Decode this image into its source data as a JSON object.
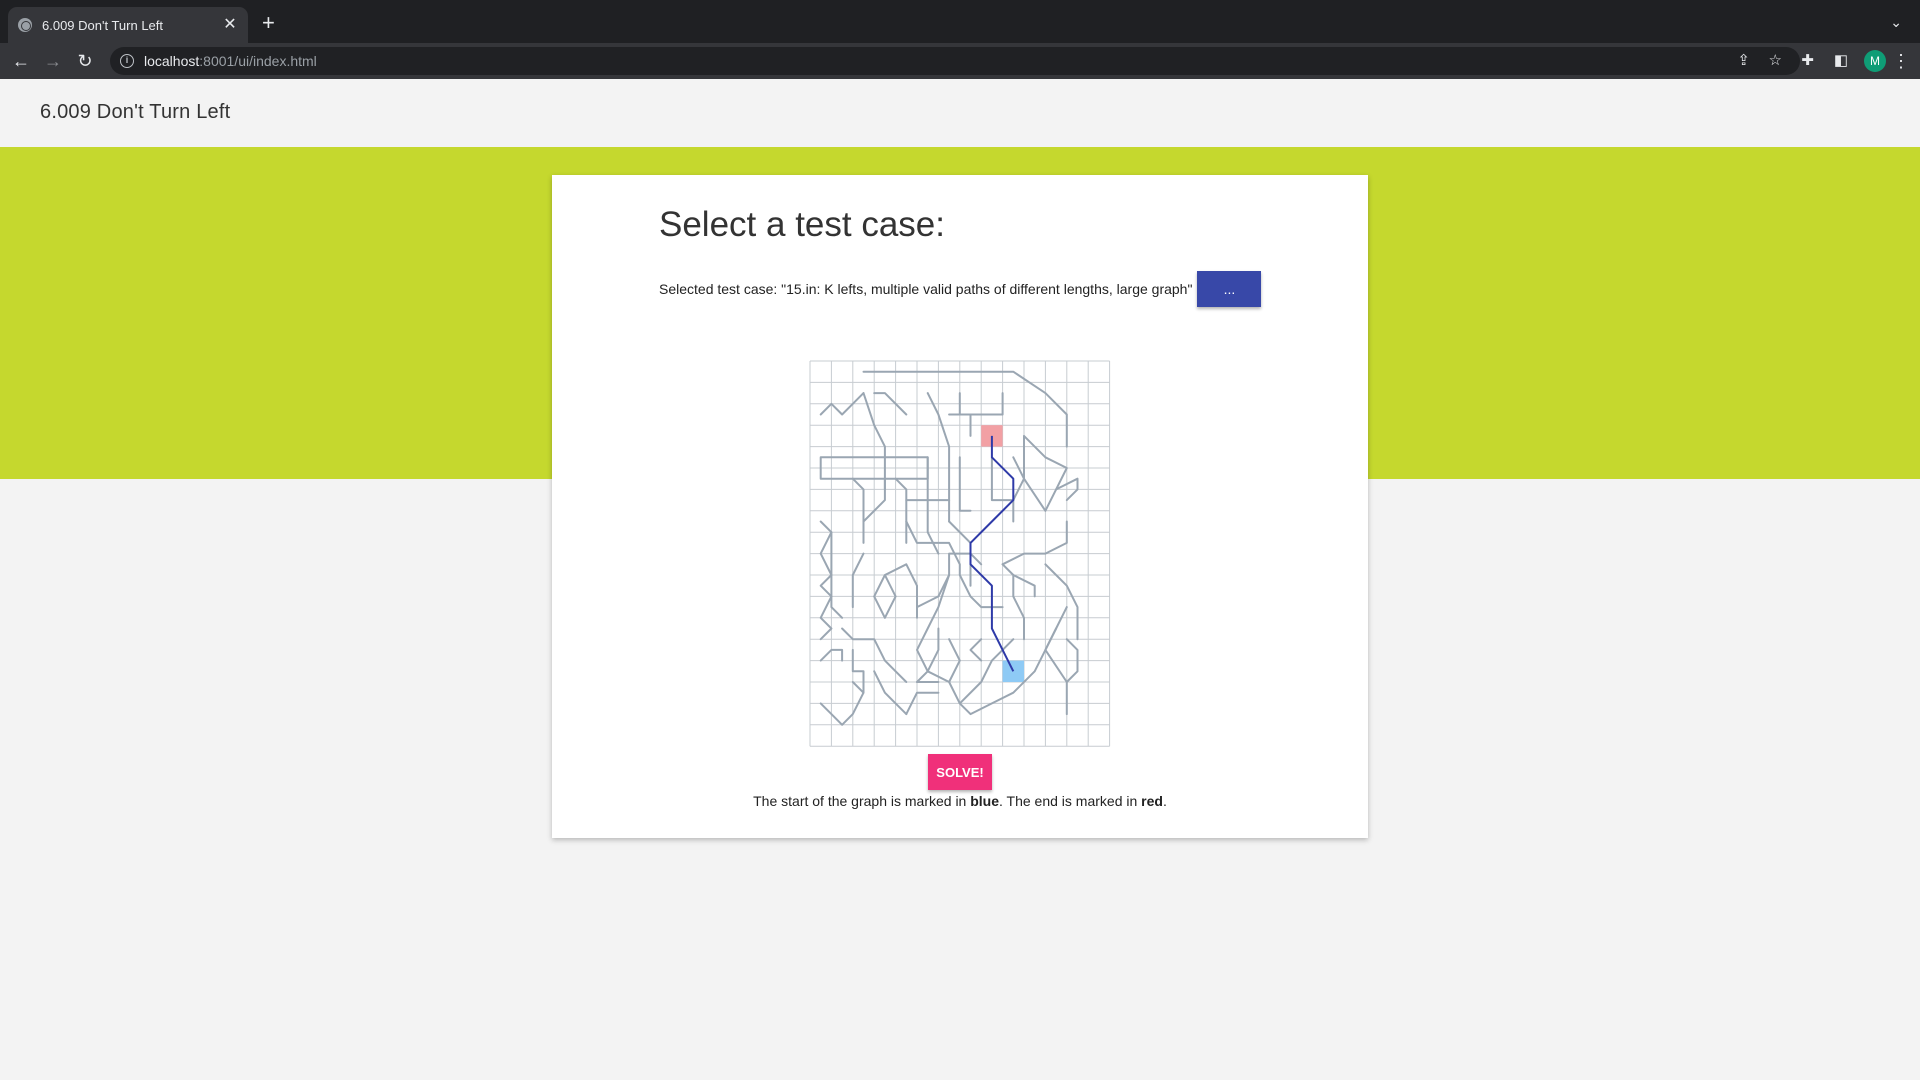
{
  "browser": {
    "tab_title": "6.009 Don't Turn Left",
    "tab_close": "✕",
    "new_tab": "+",
    "tab_list": "⌄",
    "url_host": "localhost",
    "url_rest": ":8001/ui/index.html",
    "avatar_letter": "M"
  },
  "app": {
    "title": "6.009 Don't Turn Left"
  },
  "card": {
    "heading": "Select a test case:",
    "selected_label": "Selected test case: \"15.in: K lefts, multiple valid paths of different lengths, large graph\"",
    "pick_button": "...",
    "solve_button": "SOLVE!",
    "legend_prefix": "The start of the graph is marked in ",
    "legend_start_word": "blue",
    "legend_middle": ". The end is marked in ",
    "legend_end_word": "red",
    "legend_suffix": "."
  },
  "graph": {
    "cols": 14,
    "rows": 18,
    "colors": {
      "grid": "#c7ccd1",
      "edges": "#9aa6b2",
      "path": "#2e3aa8",
      "start": "#8ecaf5",
      "end": "#f2a0a4"
    },
    "start_cell": [
      9,
      14
    ],
    "end_cell": [
      8,
      3
    ],
    "path": [
      [
        9,
        14
      ],
      [
        8,
        12
      ],
      [
        8,
        10
      ],
      [
        7,
        9
      ],
      [
        7,
        8
      ],
      [
        8,
        7
      ],
      [
        9,
        6
      ],
      [
        9,
        5
      ],
      [
        8,
        4
      ],
      [
        8,
        3
      ]
    ],
    "edges": [
      [
        [
          2.5,
          0.5
        ],
        [
          9.5,
          0.5
        ],
        [
          11,
          1.5
        ],
        [
          12,
          2.5
        ],
        [
          12,
          4
        ]
      ],
      [
        [
          0.5,
          2.5
        ],
        [
          1,
          2
        ],
        [
          1.5,
          2.5
        ],
        [
          2,
          2
        ],
        [
          2.5,
          1.5
        ]
      ],
      [
        [
          2.5,
          1.5
        ],
        [
          3,
          3
        ],
        [
          3.5,
          4
        ],
        [
          3.5,
          6
        ]
      ],
      [
        [
          3,
          1.5
        ],
        [
          3.5,
          1.5
        ],
        [
          4.5,
          2.5
        ]
      ],
      [
        [
          5.5,
          1.5
        ],
        [
          6,
          2.5
        ],
        [
          6.5,
          4
        ],
        [
          6.5,
          7.5
        ]
      ],
      [
        [
          7,
          1.5
        ],
        [
          7,
          2.5
        ],
        [
          9,
          2.5
        ],
        [
          9,
          1.5
        ]
      ],
      [
        [
          6.5,
          2.5
        ],
        [
          8.5,
          2.5
        ]
      ],
      [
        [
          7.5,
          2.5
        ],
        [
          7.5,
          3.5
        ]
      ],
      [
        [
          0.5,
          4.5
        ],
        [
          0.5,
          5.5
        ],
        [
          5.5,
          5.5
        ],
        [
          5.5,
          4.5
        ],
        [
          0.5,
          4.5
        ]
      ],
      [
        [
          5.5,
          4.5
        ],
        [
          5.5,
          8
        ],
        [
          6,
          9
        ]
      ],
      [
        [
          7,
          4.5
        ],
        [
          7,
          7
        ],
        [
          7.5,
          7
        ]
      ],
      [
        [
          8.5,
          4.5
        ],
        [
          8.5,
          6.5
        ],
        [
          9.5,
          6.5
        ]
      ],
      [
        [
          10,
          3.5
        ],
        [
          11,
          4.5
        ],
        [
          12,
          5
        ],
        [
          11.5,
          6
        ],
        [
          11,
          7
        ],
        [
          10,
          5.5
        ],
        [
          10,
          3.5
        ]
      ],
      [
        [
          11.5,
          6
        ],
        [
          12.5,
          5.5
        ],
        [
          12.5,
          6
        ],
        [
          12,
          6.5
        ]
      ],
      [
        [
          9.5,
          4.5
        ],
        [
          10,
          5.5
        ],
        [
          9.5,
          6.5
        ],
        [
          9.5,
          7.5
        ]
      ],
      [
        [
          2,
          5.5
        ],
        [
          2.5,
          6
        ],
        [
          2.5,
          8.5
        ]
      ],
      [
        [
          4,
          5.5
        ],
        [
          4.5,
          6
        ],
        [
          4.5,
          8.5
        ]
      ],
      [
        [
          4.5,
          6.5
        ],
        [
          6.5,
          6.5
        ]
      ],
      [
        [
          3.5,
          5.5
        ],
        [
          3.5,
          6.5
        ],
        [
          2.5,
          7.5
        ]
      ],
      [
        [
          4.5,
          7.5
        ],
        [
          5,
          8.5
        ],
        [
          6.5,
          8.5
        ],
        [
          7,
          9.5
        ],
        [
          7,
          10
        ],
        [
          7.5,
          11
        ],
        [
          8,
          11.5
        ],
        [
          9,
          11.5
        ]
      ],
      [
        [
          6.5,
          7.5
        ],
        [
          7.5,
          8.5
        ],
        [
          7.5,
          10.5
        ]
      ],
      [
        [
          0.5,
          7.5
        ],
        [
          1,
          8
        ],
        [
          0.5,
          9
        ],
        [
          1,
          10
        ],
        [
          0.5,
          10.5
        ],
        [
          1,
          11
        ],
        [
          0.5,
          12
        ],
        [
          1,
          12.5
        ],
        [
          0.5,
          13
        ]
      ],
      [
        [
          1,
          8
        ],
        [
          1,
          11.5
        ],
        [
          1.5,
          12
        ]
      ],
      [
        [
          2.5,
          9
        ],
        [
          2,
          10
        ],
        [
          2,
          11.5
        ]
      ],
      [
        [
          3.5,
          10
        ],
        [
          3,
          11
        ],
        [
          3.5,
          12
        ],
        [
          4,
          11
        ],
        [
          3.5,
          10
        ],
        [
          4.5,
          9.5
        ],
        [
          5,
          10.5
        ],
        [
          5,
          12
        ]
      ],
      [
        [
          5,
          11.5
        ],
        [
          6,
          11
        ],
        [
          6.5,
          10
        ],
        [
          6.5,
          9
        ],
        [
          7.5,
          9
        ],
        [
          8,
          9.5
        ]
      ],
      [
        [
          6.5,
          10
        ],
        [
          6,
          11.5
        ],
        [
          5.5,
          12.5
        ],
        [
          5,
          13.5
        ],
        [
          5.5,
          14.5
        ],
        [
          5,
          15
        ]
      ],
      [
        [
          9,
          9.5
        ],
        [
          10,
          9
        ],
        [
          11,
          9
        ],
        [
          12,
          8.5
        ],
        [
          12,
          7.5
        ]
      ],
      [
        [
          9,
          9.5
        ],
        [
          9.5,
          10
        ],
        [
          10.5,
          10.5
        ],
        [
          10.5,
          11
        ]
      ],
      [
        [
          9.5,
          10
        ],
        [
          9.5,
          11
        ],
        [
          10,
          12
        ],
        [
          10,
          13
        ]
      ],
      [
        [
          11,
          9.5
        ],
        [
          11.5,
          10
        ],
        [
          12,
          10.5
        ],
        [
          12.5,
          11.5
        ],
        [
          12.5,
          13
        ]
      ],
      [
        [
          1.5,
          12.5
        ],
        [
          2,
          13
        ],
        [
          3,
          13
        ],
        [
          3.5,
          14
        ],
        [
          4,
          14.5
        ],
        [
          4.5,
          15
        ]
      ],
      [
        [
          0.5,
          14
        ],
        [
          1,
          13.5
        ],
        [
          1.5,
          13.5
        ],
        [
          1.5,
          14
        ]
      ],
      [
        [
          2,
          13.5
        ],
        [
          2,
          14.5
        ],
        [
          2.5,
          14.5
        ],
        [
          2.5,
          15.5
        ],
        [
          2,
          16.5
        ],
        [
          1.5,
          17
        ],
        [
          1,
          16.5
        ],
        [
          0.5,
          16
        ]
      ],
      [
        [
          3,
          14.5
        ],
        [
          3.5,
          15.5
        ],
        [
          4,
          16
        ],
        [
          4.5,
          16.5
        ]
      ],
      [
        [
          6,
          12.5
        ],
        [
          6,
          13.5
        ],
        [
          5.5,
          14.5
        ],
        [
          6.5,
          15
        ],
        [
          7,
          16
        ],
        [
          8,
          15
        ],
        [
          8.5,
          14
        ],
        [
          9,
          13.5
        ],
        [
          9.5,
          13
        ]
      ],
      [
        [
          6.5,
          13
        ],
        [
          7,
          14
        ],
        [
          6.5,
          15
        ]
      ],
      [
        [
          7,
          16
        ],
        [
          7.5,
          16.5
        ],
        [
          8.5,
          16
        ],
        [
          9.5,
          15.5
        ],
        [
          10.5,
          14.5
        ],
        [
          11,
          13.5
        ],
        [
          11.5,
          12.5
        ],
        [
          12,
          11.5
        ]
      ],
      [
        [
          11.5,
          12.5
        ],
        [
          11,
          13.5
        ],
        [
          12,
          15
        ],
        [
          12.5,
          14.5
        ],
        [
          12.5,
          13.5
        ],
        [
          12,
          13
        ]
      ],
      [
        [
          12,
          15
        ],
        [
          12,
          16.5
        ]
      ],
      [
        [
          8,
          13
        ],
        [
          7.5,
          13.5
        ],
        [
          8,
          14
        ]
      ],
      [
        [
          2,
          15
        ],
        [
          2.5,
          15.5
        ]
      ],
      [
        [
          4.5,
          16.5
        ],
        [
          5,
          15.5
        ],
        [
          6,
          15.5
        ]
      ],
      [
        [
          5,
          15
        ],
        [
          6,
          15
        ]
      ]
    ]
  }
}
